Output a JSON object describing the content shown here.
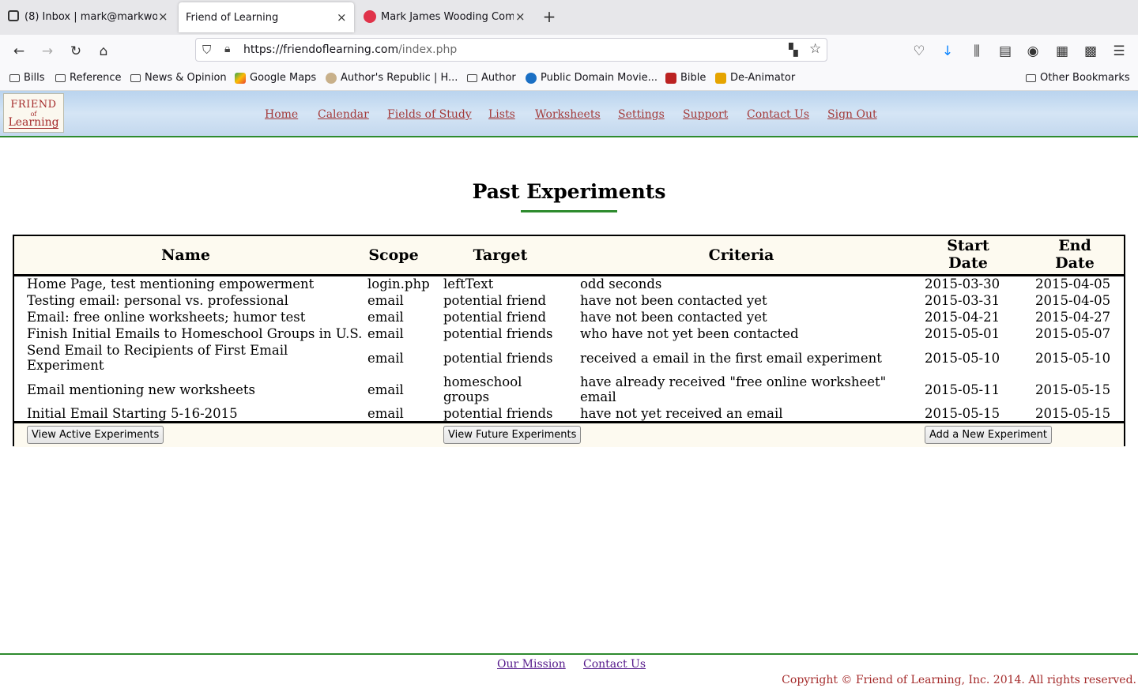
{
  "browser": {
    "tabs": [
      {
        "title": "(8) Inbox | mark@markwo"
      },
      {
        "title": "Friend of Learning"
      },
      {
        "title": "Mark James Wooding Com"
      }
    ],
    "url_host": "https://friendoflearning.com",
    "url_path": "/index.php",
    "bookmarks": [
      "Bills",
      "Reference",
      "News & Opinion",
      "Google Maps",
      "Author's Republic | H...",
      "Author",
      "Public Domain Movie...",
      "Bible",
      "De-Animator"
    ],
    "other_bookmarks": "Other Bookmarks"
  },
  "site": {
    "logo": {
      "line1": "Friend",
      "line2": "of",
      "line3": "Learning"
    },
    "nav": [
      "Home",
      "Calendar",
      "Fields of Study",
      "Lists",
      "Worksheets",
      "Settings",
      "Support",
      "Contact Us",
      "Sign Out"
    ]
  },
  "page": {
    "title": "Past Experiments",
    "columns": {
      "name": "Name",
      "scope": "Scope",
      "target": "Target",
      "criteria": "Criteria",
      "start1": "Start",
      "start2": "Date",
      "end1": "End",
      "end2": "Date"
    },
    "rows": [
      {
        "name": "Home Page, test mentioning empowerment",
        "name2": "",
        "scope": "login.php",
        "target": "leftText",
        "target2": "",
        "criteria": "odd seconds",
        "criteria2": "",
        "start": "2015-03-30",
        "end": "2015-04-05"
      },
      {
        "name": "Testing email: personal vs. professional",
        "name2": "",
        "scope": "email",
        "target": "potential friend",
        "target2": "",
        "criteria": "have not been contacted yet",
        "criteria2": "",
        "start": "2015-03-31",
        "end": "2015-04-05"
      },
      {
        "name": "Email: free online worksheets; humor test",
        "name2": "",
        "scope": "email",
        "target": "potential friend",
        "target2": "",
        "criteria": "have not been contacted yet",
        "criteria2": "",
        "start": "2015-04-21",
        "end": "2015-04-27"
      },
      {
        "name": "Finish Initial Emails to Homeschool Groups in U.S.",
        "name2": "",
        "scope": "email",
        "target": "potential friends",
        "target2": "",
        "criteria": "who have not yet been contacted",
        "criteria2": "",
        "start": "2015-05-01",
        "end": "2015-05-07"
      },
      {
        "name": "Send Email to Recipients of First Email",
        "name2": "Experiment",
        "scope": "email",
        "target": "potential friends",
        "target2": "",
        "criteria": "received a email in the first email experiment",
        "criteria2": "",
        "start": "2015-05-10",
        "end": "2015-05-10"
      },
      {
        "name": "Email mentioning new worksheets",
        "name2": "",
        "scope": "email",
        "target": "homeschool",
        "target2": "groups",
        "criteria": "have already received \"free online worksheet\"",
        "criteria2": "email",
        "start": "2015-05-11",
        "end": "2015-05-15"
      },
      {
        "name": "Initial Email Starting 5-16-2015",
        "name2": "",
        "scope": "email",
        "target": "potential friends",
        "target2": "",
        "criteria": "have not yet received an email",
        "criteria2": "",
        "start": "2015-05-15",
        "end": "2015-05-15"
      }
    ],
    "buttons": {
      "active": "View Active Experiments",
      "future": "View Future Experiments",
      "add": "Add a New Experiment"
    }
  },
  "footer": {
    "links": [
      "Our Mission",
      "Contact Us"
    ],
    "copyright": "Copyright © Friend of Learning, Inc. 2014. All rights reserved."
  }
}
